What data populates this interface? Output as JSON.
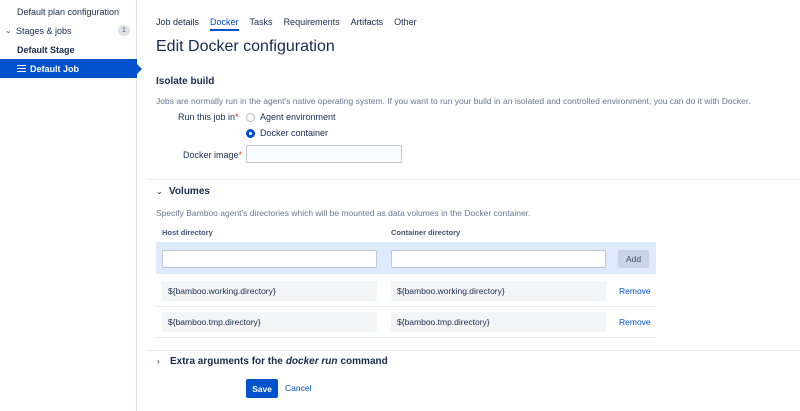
{
  "sidebar": {
    "plan_config": "Default plan configuration",
    "stages_label": "Stages & jobs",
    "stages_count": "1",
    "stage": "Default Stage",
    "job": "Default Job"
  },
  "tabs": [
    {
      "label": "Job details",
      "active": false
    },
    {
      "label": "Docker",
      "active": true
    },
    {
      "label": "Tasks",
      "active": false
    },
    {
      "label": "Requirements",
      "active": false
    },
    {
      "label": "Artifacts",
      "active": false
    },
    {
      "label": "Other",
      "active": false
    }
  ],
  "page_title": "Edit Docker configuration",
  "isolate": {
    "title": "Isolate build",
    "description": "Jobs are normally run in the agent's native operating system. If you want to run your build in an isolated and controlled environment, you can do it with Docker.",
    "run_label": "Run this job in",
    "required_mark": "*",
    "options": [
      {
        "label": "Agent environment",
        "checked": false
      },
      {
        "label": "Docker container",
        "checked": true
      }
    ],
    "image_label": "Docker image",
    "image_value": ""
  },
  "volumes": {
    "title": "Volumes",
    "description": "Specify Bamboo agent's directories which will be mounted as data volumes in the Docker container.",
    "host_header": "Host directory",
    "container_header": "Container directory",
    "host_input": "",
    "container_input": "",
    "add_label": "Add",
    "rows": [
      {
        "host": "${bamboo.working.directory}",
        "container": "${bamboo.working.directory}",
        "remove": "Remove"
      },
      {
        "host": "${bamboo.tmp.directory}",
        "container": "${bamboo.tmp.directory}",
        "remove": "Remove"
      }
    ]
  },
  "extra": {
    "prefix": "Extra arguments for the",
    "italic": "docker run",
    "suffix": "command"
  },
  "actions": {
    "save": "Save",
    "cancel": "Cancel"
  },
  "colors": {
    "primary": "#0052cc",
    "add_row_bg": "#deebff",
    "required": "#de350b"
  }
}
